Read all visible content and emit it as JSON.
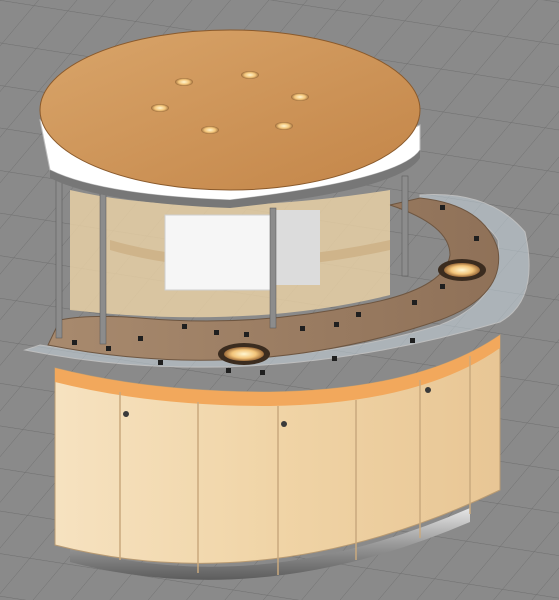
{
  "viewport": {
    "background_color": "#8a8a8a",
    "grid_color": "#6f6f6f"
  },
  "model": {
    "wood_color": "#c98f55",
    "cabinet_color": "#f1d7ae",
    "counter_color": "#9a7a5e",
    "steel_color": "#bdbdbd",
    "trim_color": "#ffffff",
    "glass_color": "#c8d6df",
    "recessed_lights": 6,
    "counter_wells": 2,
    "cabinet_doors": 6
  }
}
